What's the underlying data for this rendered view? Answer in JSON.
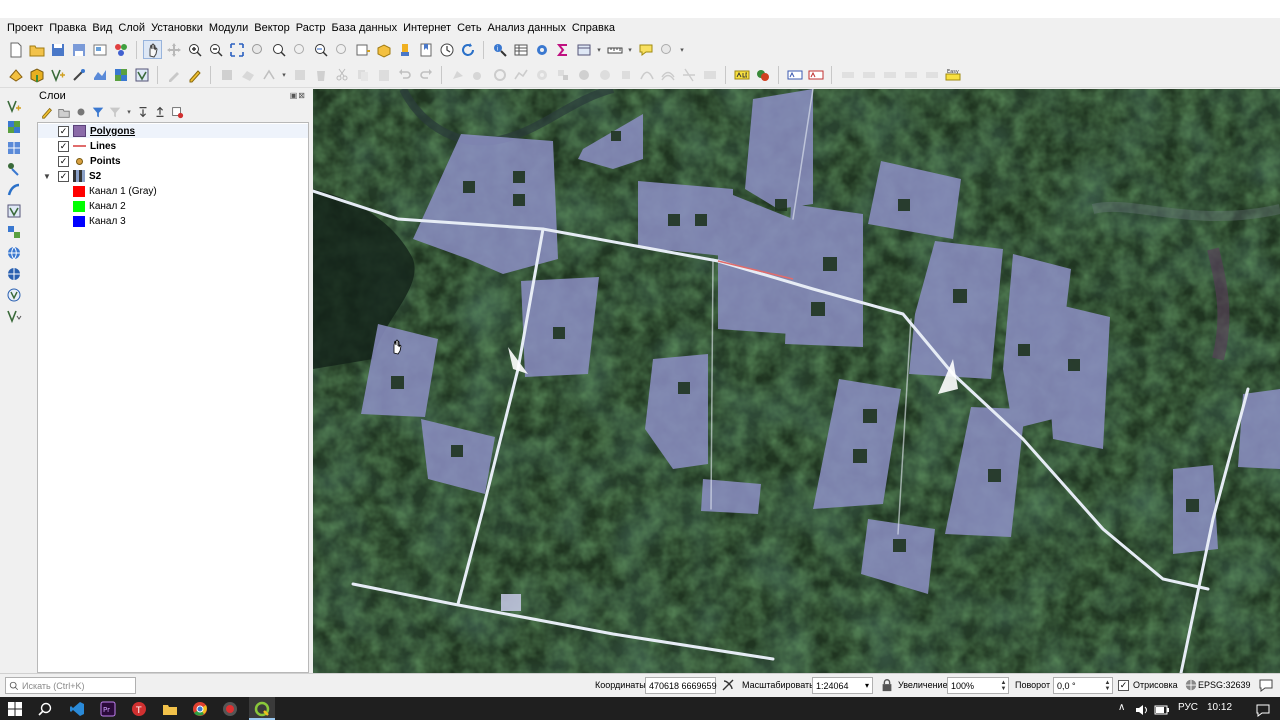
{
  "menu": [
    "Проект",
    "Правка",
    "Вид",
    "Слой",
    "Установки",
    "Модули",
    "Вектор",
    "Растр",
    "База данных",
    "Интернет",
    "Сеть",
    "Анализ данных",
    "Справка"
  ],
  "layers_panel": {
    "title": "Слои",
    "layers": [
      {
        "name": "Polygons",
        "checked": true,
        "swatch": "#8a6aa8",
        "kind": "polygon"
      },
      {
        "name": "Lines",
        "checked": true,
        "swatch": "#e06c6c",
        "kind": "line"
      },
      {
        "name": "Points",
        "checked": true,
        "swatch": "#d8a040",
        "kind": "point"
      },
      {
        "name": "S2",
        "checked": true,
        "kind": "raster",
        "expanded": true,
        "bands": [
          {
            "name": "Канал 1 (Gray)",
            "color": "#ff0000"
          },
          {
            "name": "Канал 2",
            "color": "#00ff00"
          },
          {
            "name": "Канал 3",
            "color": "#0000ff"
          }
        ]
      }
    ],
    "check_mark": "✓"
  },
  "statusbar": {
    "search_placeholder": "Искать (Ctrl+K)",
    "coords_label": "Координаты",
    "coords_value": "470618 6669659",
    "scale_label": "Масштабировать",
    "scale_value": "1:24064",
    "magnify_label": "Увеличение",
    "magnify_value": "100%",
    "rotation_label": "Поворот",
    "rotation_value": "0,0 °",
    "render_label": "Отрисовка",
    "render_checked": true,
    "crs": "EPSG:32639"
  },
  "taskbar": {
    "language": "РУС",
    "time": "10:12"
  },
  "colors": {
    "accent": "#9ac8f0",
    "map_dark": "#1d2f1b",
    "clearing": "#8c8fc4"
  }
}
